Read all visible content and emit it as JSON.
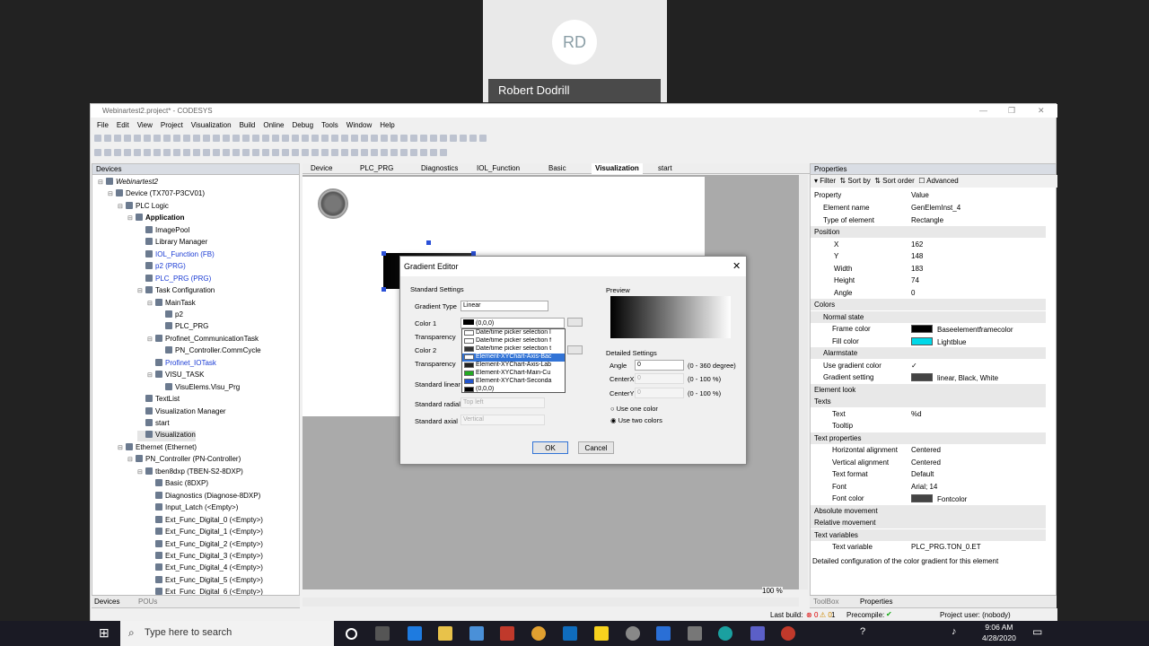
{
  "meeting": {
    "initials": "RD",
    "participant_name": "Robert Dodrill"
  },
  "window": {
    "title": "Webinartest2.project* - CODESYS"
  },
  "menu": [
    "File",
    "Edit",
    "View",
    "Project",
    "Visualization",
    "Build",
    "Online",
    "Debug",
    "Tools",
    "Window",
    "Help"
  ],
  "devices_panel": {
    "title": "Devices",
    "tabs": [
      "Devices",
      "POUs"
    ],
    "tree": [
      "Webinartest2",
      "Device (TX707-P3CV01)",
      "PLC Logic",
      "Application",
      "ImagePool",
      "Library Manager",
      "IOL_Function (FB)",
      "p2 (PRG)",
      "PLC_PRG (PRG)",
      "Task Configuration",
      "MainTask",
      "p2",
      "PLC_PRG",
      "Profinet_CommunicationTask",
      "PN_Controller.CommCycle",
      "Profinet_IOTask",
      "VISU_TASK",
      "VisuElems.Visu_Prg",
      "TextList",
      "Visualization Manager",
      "start",
      "Visualization",
      "Ethernet (Ethernet)",
      "PN_Controller (PN-Controller)",
      "tben8dxp (TBEN-S2-8DXP)",
      "Basic (8DXP)",
      "Diagnostics (Diagnose-8DXP)",
      "Input_Latch (<Empty>)",
      "Ext_Func_Digital_0 (<Empty>)",
      "Ext_Func_Digital_1 (<Empty>)",
      "Ext_Func_Digital_2 (<Empty>)",
      "Ext_Func_Digital_3 (<Empty>)",
      "Ext_Func_Digital_4 (<Empty>)",
      "Ext_Func_Digital_5 (<Empty>)",
      "Ext_Func_Digital_6 (<Empty>)"
    ]
  },
  "editor_tabs": [
    "Device",
    "PLC_PRG",
    "Diagnostics",
    "IOL_Function",
    "Basic",
    "Visualization",
    "start"
  ],
  "zoom": "100 %",
  "properties": {
    "title": "Properties",
    "toolbar": {
      "filter": "Filter",
      "sort_by": "Sort by",
      "sort_order": "Sort order",
      "advanced": "Advanced"
    },
    "col_property": "Property",
    "col_value": "Value",
    "rows": [
      {
        "name": "Element name",
        "value": "GenElemInst_4"
      },
      {
        "name": "Type of element",
        "value": "Rectangle"
      },
      {
        "name": "Position",
        "value": "",
        "group": true
      },
      {
        "name": "X",
        "value": "162"
      },
      {
        "name": "Y",
        "value": "148"
      },
      {
        "name": "Width",
        "value": "183"
      },
      {
        "name": "Height",
        "value": "74"
      },
      {
        "name": "Angle",
        "value": "0"
      },
      {
        "name": "Colors",
        "value": "",
        "group": true
      },
      {
        "name": "Normal state",
        "value": "",
        "group": true
      },
      {
        "name": "Frame color",
        "value": "Baseelementframecolor",
        "swatch": "#000000"
      },
      {
        "name": "Fill color",
        "value": "Lightblue",
        "swatch": "#00d8e8"
      },
      {
        "name": "Alarmstate",
        "value": "",
        "group": true
      },
      {
        "name": "Use gradient color",
        "value": "✓"
      },
      {
        "name": "Gradient setting",
        "value": "linear, Black, White",
        "swatch": "#444444"
      },
      {
        "name": "Element look",
        "value": "",
        "group": true
      },
      {
        "name": "Texts",
        "value": "",
        "group": true
      },
      {
        "name": "Text",
        "value": "%d"
      },
      {
        "name": "Tooltip",
        "value": ""
      },
      {
        "name": "Text properties",
        "value": "",
        "group": true
      },
      {
        "name": "Horizontal alignment",
        "value": "Centered"
      },
      {
        "name": "Vertical alignment",
        "value": "Centered"
      },
      {
        "name": "Text format",
        "value": "Default"
      },
      {
        "name": "Font",
        "value": "Arial; 14"
      },
      {
        "name": "Font color",
        "value": "Fontcolor",
        "swatch": "#444444"
      },
      {
        "name": "Absolute movement",
        "value": "",
        "group": true
      },
      {
        "name": "Relative movement",
        "value": "",
        "group": true
      },
      {
        "name": "Text variables",
        "value": "",
        "group": true
      },
      {
        "name": "Text variable",
        "value": "PLC_PRG.TON_0.ET"
      }
    ],
    "description": "Detailed configuration of the color gradient for this element",
    "tabs": [
      "ToolBox",
      "Properties"
    ]
  },
  "statusbar": {
    "last_build": "Last build:",
    "errors": "0",
    "warnings": "0",
    "messages": "1",
    "precompile": "Precompile:",
    "project_user": "Project user: (nobody)"
  },
  "dialog": {
    "title": "Gradient Editor",
    "standard_settings": "Standard Settings",
    "gradient_type_label": "Gradient Type",
    "gradient_type": "Linear",
    "color1_label": "Color 1",
    "color1_value": "(0,0,0)",
    "transparency1": "Transparency",
    "color2_label": "Color 2",
    "transparency2": "Transparency",
    "standard_linear": "Standard linear",
    "standard_radial": "Standard radial",
    "standard_radial_value": "Top left",
    "standard_axial": "Standard axial",
    "standard_axial_value": "Vertical",
    "preview": "Preview",
    "detailed_settings": "Detailed Settings",
    "angle_label": "Angle",
    "angle_value": "0",
    "angle_range": "(0 - 360 degree)",
    "centerx_label": "CenterX",
    "centerx_value": "0",
    "centerx_range": "(0 - 100 %)",
    "centery_label": "CenterY",
    "centery_value": "0",
    "centery_range": "(0 - 100 %)",
    "use_one_color": "Use one color",
    "use_two_colors": "Use two colors",
    "ok": "OK",
    "cancel": "Cancel",
    "dropdown": [
      {
        "label": "Date/time picker selection l",
        "color": "#ffffff"
      },
      {
        "label": "Date/time picker selection f",
        "color": "#ffffff"
      },
      {
        "label": "Date/time picker selection t",
        "color": "#333333"
      },
      {
        "label": "Element-XYChart-Axis-Bac",
        "color": "#ffffff",
        "highlighted": true
      },
      {
        "label": "Element-XYChart-Axis-Lab",
        "color": "#222222"
      },
      {
        "label": "Element-XYChart-Main-Cu",
        "color": "#22aa22"
      },
      {
        "label": "Element-XYChart-Seconda",
        "color": "#2255cc"
      },
      {
        "label": "(0,0,0)",
        "color": "#000000"
      }
    ]
  },
  "taskbar": {
    "search_placeholder": "Type here to search",
    "time": "9:06 AM",
    "date": "4/28/2020"
  }
}
